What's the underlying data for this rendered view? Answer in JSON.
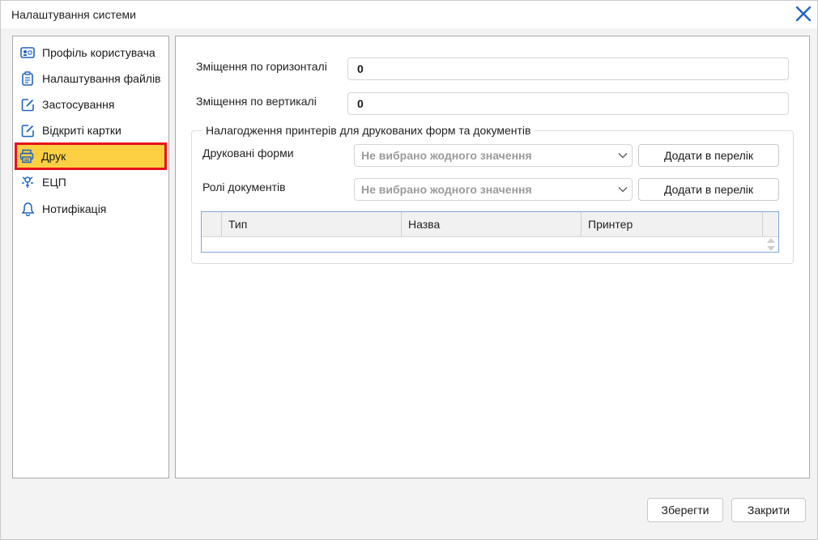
{
  "window": {
    "title": "Налаштування системи"
  },
  "sidebar": {
    "items": [
      {
        "label": "Профіль користувача",
        "icon": "user-card-icon"
      },
      {
        "label": "Налаштування файлів",
        "icon": "clipboard-icon"
      },
      {
        "label": "Застосування",
        "icon": "edit-square-icon"
      },
      {
        "label": "Відкриті картки",
        "icon": "edit-square-icon"
      },
      {
        "label": "Друк",
        "icon": "printer-icon",
        "active": true
      },
      {
        "label": "ЕЦП",
        "icon": "signature-key-icon"
      },
      {
        "label": "Нотифікація",
        "icon": "bell-icon"
      }
    ]
  },
  "settings": {
    "horizontal_offset_label": "Зміщення по горизонталі",
    "horizontal_offset_value": "0",
    "vertical_offset_label": "Зміщення по вертикалі",
    "vertical_offset_value": "0"
  },
  "printer_group": {
    "title": "Налагодження принтерів для друкованих форм та документів",
    "print_forms_label": "Друковані форми",
    "print_forms_value": "Не вибрано жодного значення",
    "doc_roles_label": "Ролі документів",
    "doc_roles_value": "Не вибрано жодного значення",
    "add_button_label": "Додати в перелік",
    "table": {
      "columns": [
        "Тип",
        "Назва",
        "Принтер"
      ],
      "rows": []
    }
  },
  "footer": {
    "save_label": "Зберегти",
    "close_label": "Закрити"
  },
  "colors": {
    "active_item_bg": "#fdd043",
    "active_item_border": "#e8111b",
    "accent": "#1e63c4"
  }
}
